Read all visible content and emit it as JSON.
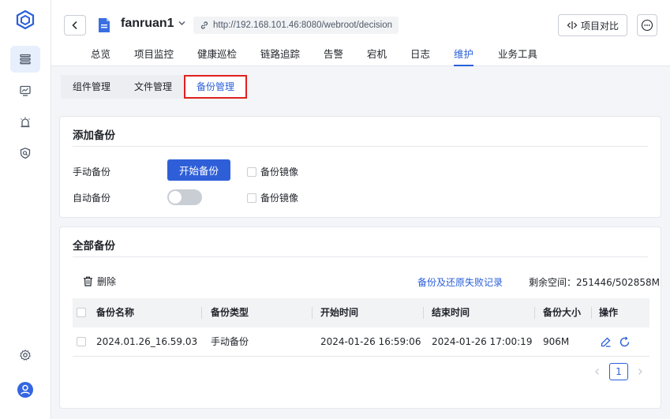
{
  "colors": {
    "accent": "#2a5fda",
    "highlight_border": "#e02020"
  },
  "rail": {
    "icons": [
      "cube-logo-icon",
      "server-icon",
      "monitor-chart-icon",
      "alarm-icon",
      "shield-search-icon",
      "gear-icon",
      "user-avatar-icon"
    ]
  },
  "header": {
    "project_name": "fanruan1",
    "url": "http://192.168.101.46:8080/webroot/decision",
    "compare_label": "项目对比",
    "nav": [
      "总览",
      "项目监控",
      "健康巡检",
      "链路追踪",
      "告警",
      "宕机",
      "日志",
      "维护",
      "业务工具"
    ],
    "active_nav": "维护"
  },
  "subtabs": [
    "组件管理",
    "文件管理",
    "备份管理"
  ],
  "add_backup": {
    "title": "添加备份",
    "manual_label": "手动备份",
    "start_button": "开始备份",
    "mirror_label_1": "备份镜像",
    "auto_label": "自动备份",
    "auto_enabled": false,
    "mirror_label_2": "备份镜像"
  },
  "all_backups": {
    "title": "全部备份",
    "delete_label": "删除",
    "fail_link": "备份及还原失败记录",
    "space": "剩余空间：251446/502858M",
    "columns": [
      "备份名称",
      "备份类型",
      "开始时间",
      "结束时间",
      "备份大小",
      "操作"
    ],
    "rows": [
      {
        "name": "2024.01.26_16.59.03",
        "type": "手动备份",
        "start": "2024-01-26 16:59:06",
        "end": "2024-01-26 17:00:19",
        "size": "906M"
      }
    ],
    "page": "1"
  }
}
